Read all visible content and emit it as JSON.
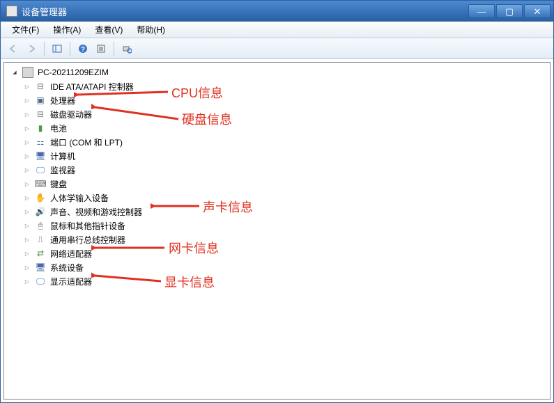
{
  "window": {
    "title": "设备管理器"
  },
  "menu": {
    "file": "文件(F)",
    "action": "操作(A)",
    "view": "查看(V)",
    "help": "帮助(H)"
  },
  "tree": {
    "root": "PC-20211209EZIM",
    "items": [
      "IDE ATA/ATAPI 控制器",
      "处理器",
      "磁盘驱动器",
      "电池",
      "端口 (COM 和 LPT)",
      "计算机",
      "监视器",
      "键盘",
      "人体学输入设备",
      "声音、视频和游戏控制器",
      "鼠标和其他指针设备",
      "通用串行总线控制器",
      "网络适配器",
      "系统设备",
      "显示适配器"
    ]
  },
  "annotations": {
    "cpu": "CPU信息",
    "disk": "硬盘信息",
    "audio": "声卡信息",
    "net": "网卡信息",
    "gpu": "显卡信息"
  }
}
